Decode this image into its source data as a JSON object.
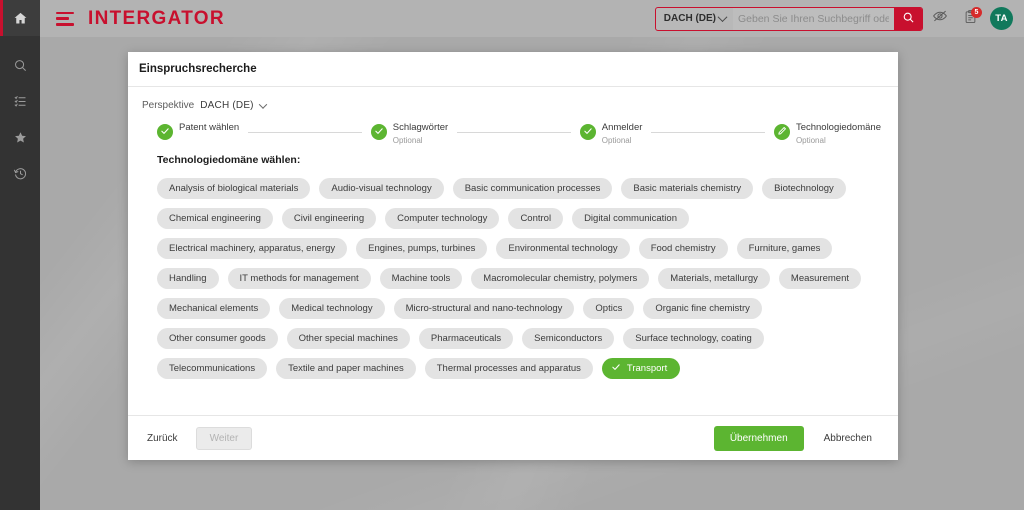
{
  "app": {
    "brand": "INTERGATOR"
  },
  "sidebar": {
    "items": [
      {
        "name": "home",
        "icon": "home-icon"
      },
      {
        "name": "search",
        "icon": "search-icon"
      },
      {
        "name": "tasks",
        "icon": "list-icon"
      },
      {
        "name": "favorites",
        "icon": "star-icon"
      },
      {
        "name": "history",
        "icon": "history-icon"
      }
    ]
  },
  "topbar": {
    "menu_icon": "hamburger-icon",
    "search": {
      "perspective_label": "DACH (DE)",
      "placeholder": "Geben Sie Ihren Suchbegriff oder die '",
      "value": "",
      "submit_icon": "search-icon"
    },
    "actions": [
      {
        "name": "privacy-toggle",
        "icon": "eye-off-icon"
      },
      {
        "name": "notes",
        "icon": "clipboard-icon",
        "badge": "5"
      }
    ],
    "avatar": "TA"
  },
  "dialog": {
    "title": "Einspruchsrecherche",
    "perspective": {
      "label": "Perspektive",
      "value": "DACH (DE)",
      "chevron_icon": "chevron-down-icon"
    },
    "steps": [
      {
        "label": "Patent wählen",
        "sub": "",
        "icon": "check-icon",
        "state": "done"
      },
      {
        "label": "Schlagwörter",
        "sub": "Optional",
        "icon": "check-icon",
        "state": "done"
      },
      {
        "label": "Anmelder",
        "sub": "Optional",
        "icon": "check-icon",
        "state": "done"
      },
      {
        "label": "Technologiedomäne",
        "sub": "Optional",
        "icon": "pencil-icon",
        "state": "active"
      }
    ],
    "section_title": "Technologiedomäne wählen:",
    "chips": [
      {
        "label": "Analysis of biological materials",
        "selected": false
      },
      {
        "label": "Audio-visual technology",
        "selected": false
      },
      {
        "label": "Basic communication processes",
        "selected": false
      },
      {
        "label": "Basic materials chemistry",
        "selected": false
      },
      {
        "label": "Biotechnology",
        "selected": false
      },
      {
        "label": "Chemical engineering",
        "selected": false
      },
      {
        "label": "Civil engineering",
        "selected": false
      },
      {
        "label": "Computer technology",
        "selected": false
      },
      {
        "label": "Control",
        "selected": false
      },
      {
        "label": "Digital communication",
        "selected": false
      },
      {
        "label": "Electrical machinery, apparatus, energy",
        "selected": false
      },
      {
        "label": "Engines, pumps, turbines",
        "selected": false
      },
      {
        "label": "Environmental technology",
        "selected": false
      },
      {
        "label": "Food chemistry",
        "selected": false
      },
      {
        "label": "Furniture, games",
        "selected": false
      },
      {
        "label": "Handling",
        "selected": false
      },
      {
        "label": "IT methods for management",
        "selected": false
      },
      {
        "label": "Machine tools",
        "selected": false
      },
      {
        "label": "Macromolecular chemistry, polymers",
        "selected": false
      },
      {
        "label": "Materials, metallurgy",
        "selected": false
      },
      {
        "label": "Measurement",
        "selected": false
      },
      {
        "label": "Mechanical elements",
        "selected": false
      },
      {
        "label": "Medical technology",
        "selected": false
      },
      {
        "label": "Micro-structural and nano-technology",
        "selected": false
      },
      {
        "label": "Optics",
        "selected": false
      },
      {
        "label": "Organic fine chemistry",
        "selected": false
      },
      {
        "label": "Other consumer goods",
        "selected": false
      },
      {
        "label": "Other special machines",
        "selected": false
      },
      {
        "label": "Pharmaceuticals",
        "selected": false
      },
      {
        "label": "Semiconductors",
        "selected": false
      },
      {
        "label": "Surface technology, coating",
        "selected": false
      },
      {
        "label": "Telecommunications",
        "selected": false
      },
      {
        "label": "Textile and paper machines",
        "selected": false
      },
      {
        "label": "Thermal processes and apparatus",
        "selected": false
      },
      {
        "label": "Transport",
        "selected": true
      }
    ],
    "footer": {
      "back": "Zurück",
      "next": "Weiter",
      "apply": "Übernehmen",
      "cancel": "Abbrechen"
    }
  },
  "colors": {
    "brand_red": "#c8102e",
    "accent_green": "#5cb531",
    "avatar_green": "#11795c",
    "badge_red": "#d62b2b",
    "topbar_grey": "#b3b3b3",
    "sidebar_dark": "#333333"
  }
}
